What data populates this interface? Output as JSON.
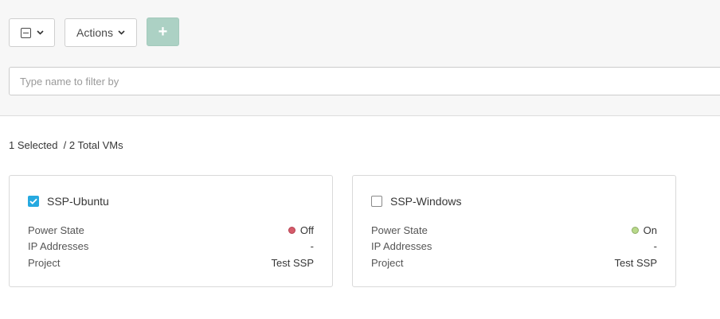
{
  "toolbar": {
    "select_icon": "minus-checkbox-icon",
    "chevron_icon": "chevron-down-icon",
    "actions_label": "Actions",
    "add_label": "+",
    "add_button_color": "#acd1c4"
  },
  "filter": {
    "placeholder": "Type name to filter by",
    "value": ""
  },
  "summary": {
    "selected": "1 Selected",
    "total": "  / 2 Total VMs"
  },
  "vms": [
    {
      "name": "SSP-Ubuntu",
      "checked": true,
      "rows": [
        {
          "label": "Power State",
          "value": "Off",
          "status_color": "#d55c6a"
        },
        {
          "label": "IP Addresses",
          "value": "-"
        },
        {
          "label": "Project",
          "value": "Test SSP"
        }
      ]
    },
    {
      "name": "SSP-Windows",
      "checked": false,
      "rows": [
        {
          "label": "Power State",
          "value": "On",
          "status_color": "#b8d98a"
        },
        {
          "label": "IP Addresses",
          "value": "-"
        },
        {
          "label": "Project",
          "value": "Test SSP"
        }
      ]
    }
  ],
  "colors": {
    "checkbox_checked": "#26a9e0",
    "toolbar_background": "#f7f7f7"
  }
}
